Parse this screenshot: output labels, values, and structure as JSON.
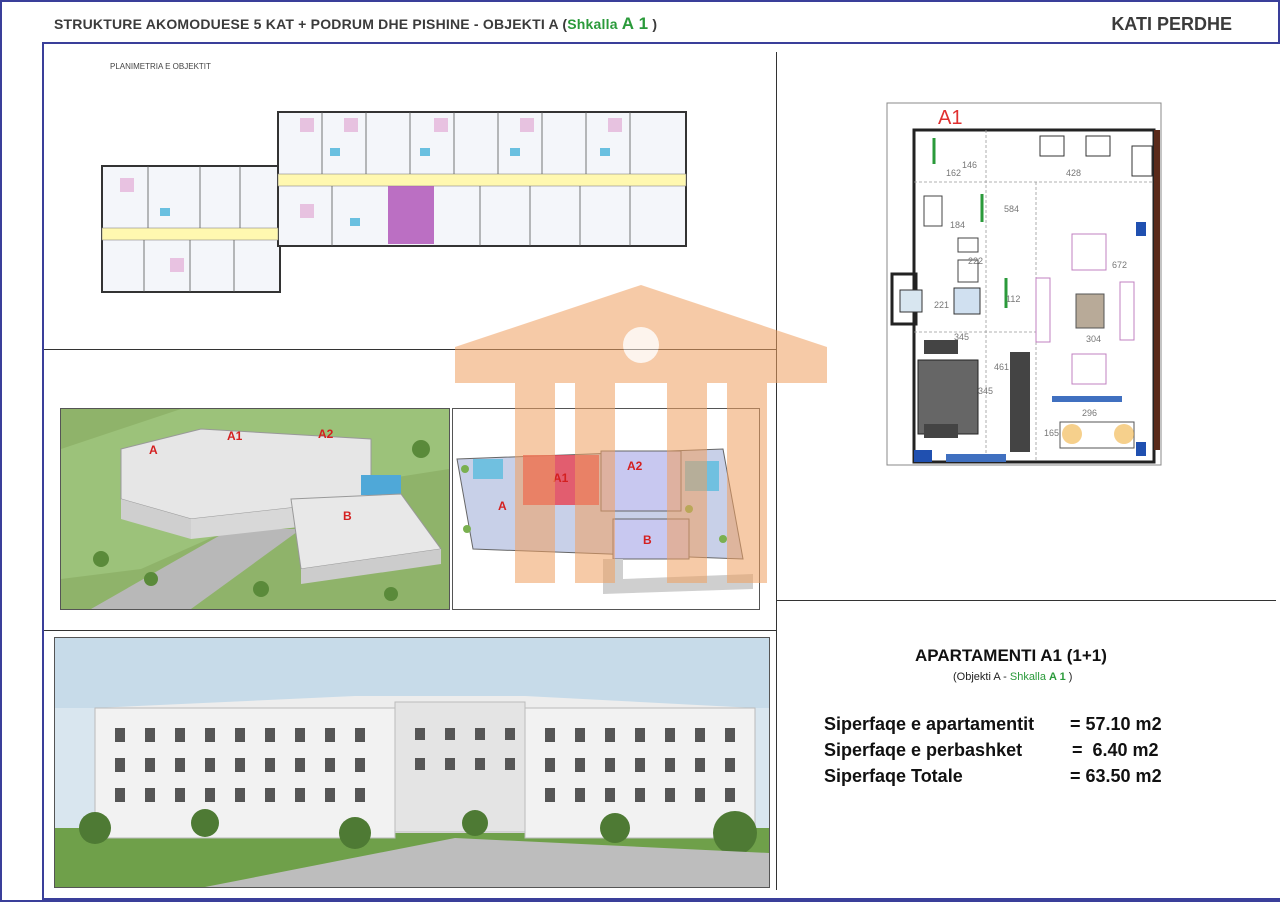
{
  "header": {
    "title_part1": "STRUKTURE AKOMODUESE 5 KAT + PODRUM DHE PISHINE   -  OBJEKTI A (",
    "title_green": "Shkalla",
    "title_green_big": "A 1",
    "title_close": " )",
    "right_title": "KATI PERDHE"
  },
  "floorplan": {
    "label": "PLANIMETRIA E OBJEKTIT",
    "unit_tag": "A1",
    "dimensions": [
      "146",
      "162",
      "428",
      "584",
      "184",
      "222",
      "221",
      "112",
      "672",
      "345",
      "304",
      "461",
      "345",
      "296",
      "165"
    ]
  },
  "aerial": {
    "labels": [
      "A",
      "A1",
      "A2",
      "B"
    ]
  },
  "siteplan": {
    "labels": [
      "A",
      "A1",
      "A2",
      "B"
    ]
  },
  "apartment": {
    "title": "APARTAMENTI A1 (1+1)",
    "sub_open": "(Objekti A - ",
    "sub_green": "Shkalla ",
    "sub_bold": "A 1",
    "sub_close": " )",
    "rows": [
      {
        "label": "Siperfaqe e apartamentit",
        "value": "= 57.10 m2"
      },
      {
        "label": "Siperfaqe e perbashket",
        "value": "=  6.40 m2"
      },
      {
        "label": "Siperfaqe Totale",
        "value": "= 63.50 m2"
      }
    ]
  },
  "colors": {
    "border": "#3a3f9a",
    "accent_green": "#2a9a3a",
    "label_red": "#d42020",
    "watermark": "#f0a060"
  }
}
